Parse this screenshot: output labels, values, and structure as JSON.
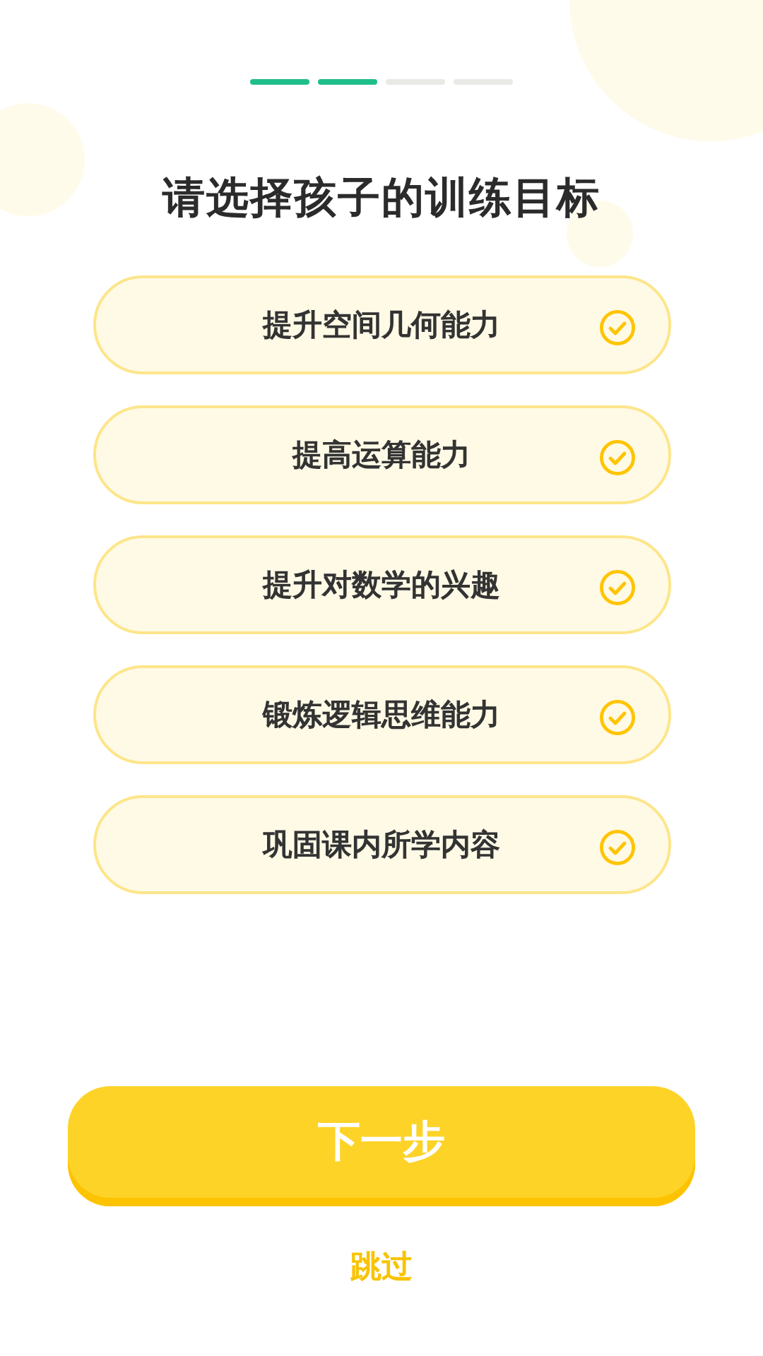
{
  "progress": {
    "steps": [
      {
        "done": true
      },
      {
        "done": true
      },
      {
        "done": false
      },
      {
        "done": false
      }
    ]
  },
  "title": "请选择孩子的训练目标",
  "options": [
    {
      "label": "提升空间几何能力",
      "selected": false
    },
    {
      "label": "提高运算能力",
      "selected": false
    },
    {
      "label": "提升对数学的兴趣",
      "selected": false
    },
    {
      "label": "锻炼逻辑思维能力",
      "selected": false
    },
    {
      "label": "巩固课内所学内容",
      "selected": false
    }
  ],
  "next_button": "下一步",
  "skip_link": "跳过"
}
